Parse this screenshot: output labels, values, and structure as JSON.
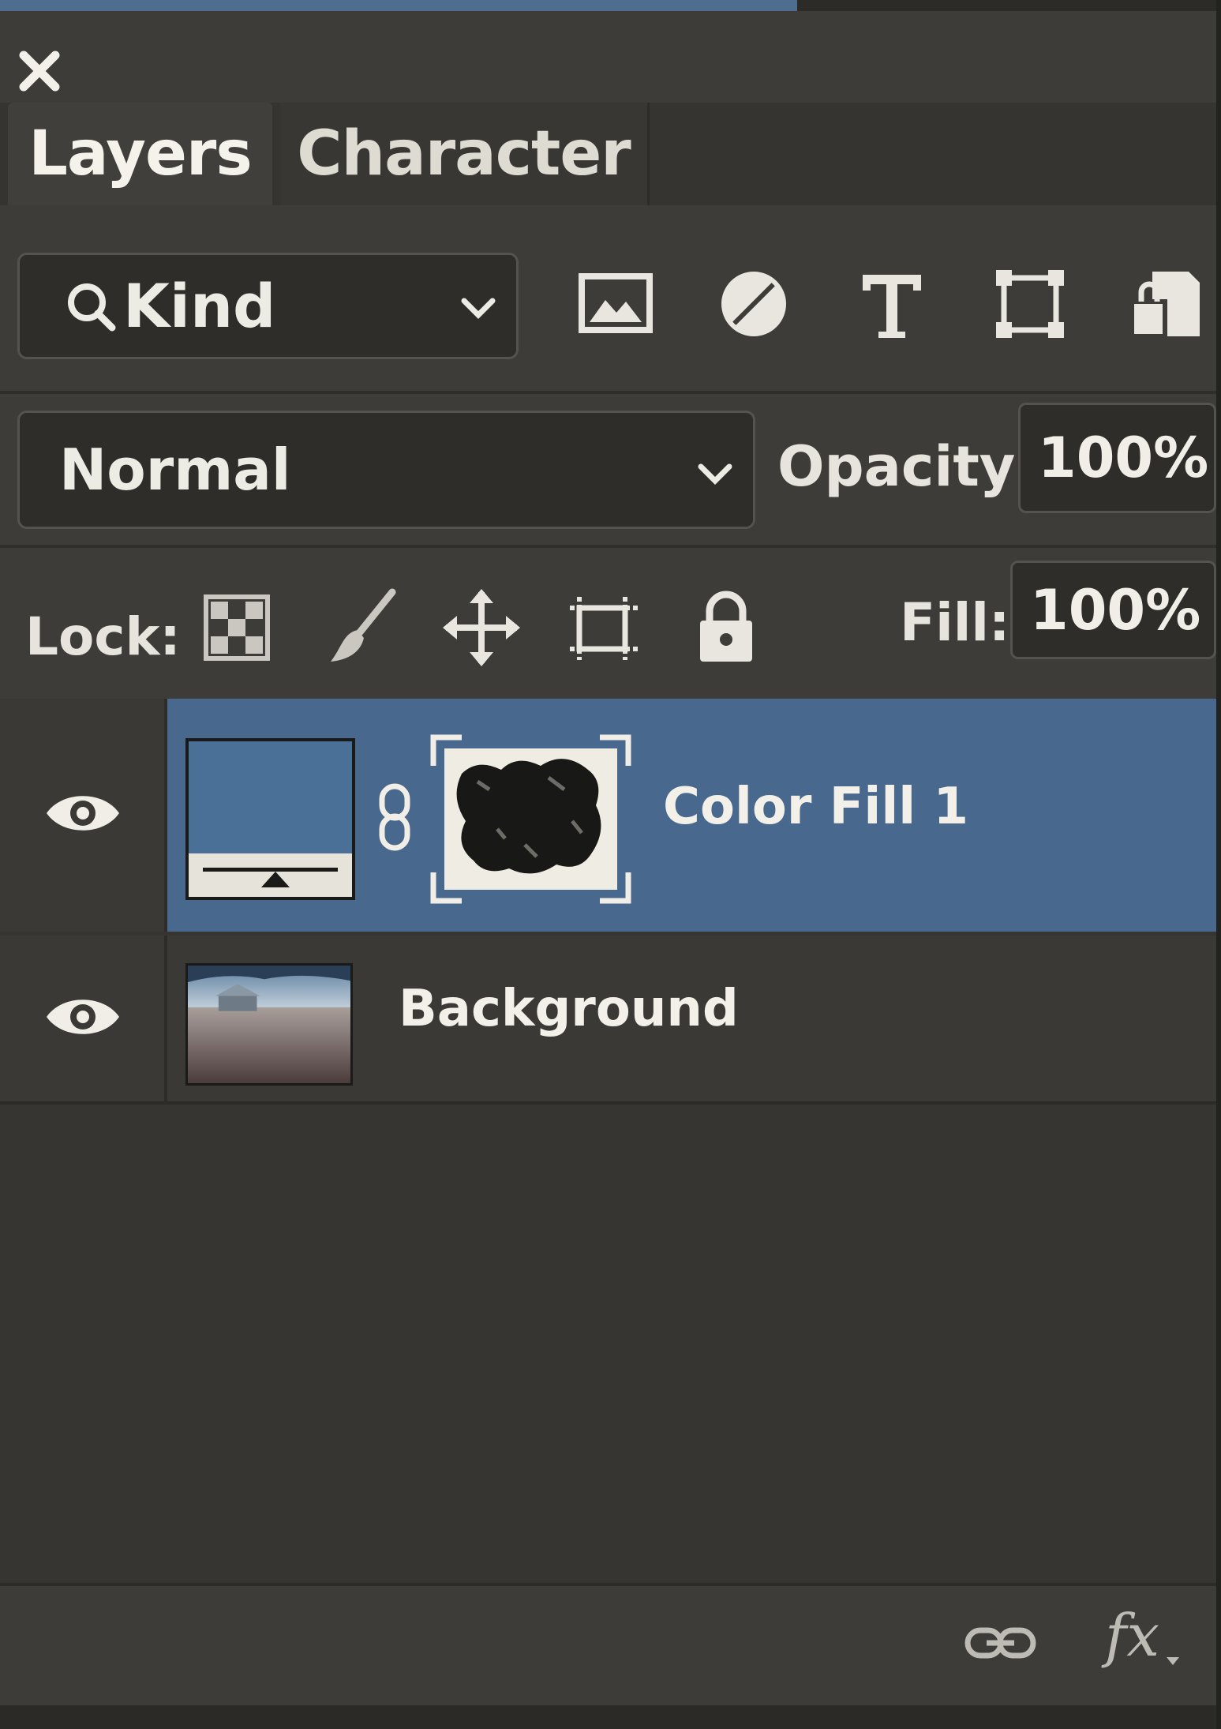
{
  "panel": {
    "tabs": [
      {
        "label": "Layers",
        "active": true
      },
      {
        "label": "Character",
        "active": false
      }
    ]
  },
  "filter": {
    "kind_label": "Kind",
    "filter_icons": [
      "image-filter-icon",
      "adjustment-filter-icon",
      "type-filter-icon",
      "shape-filter-icon",
      "smart-object-filter-icon"
    ]
  },
  "blend": {
    "mode": "Normal",
    "opacity_label": "Opacity:",
    "opacity_value": "100%"
  },
  "lock": {
    "label": "Lock:",
    "icons": [
      "lock-transparent-pixels-icon",
      "lock-image-pixels-icon",
      "lock-position-icon",
      "lock-artboard-icon",
      "lock-all-icon"
    ],
    "fill_label": "Fill:",
    "fill_value": "100%"
  },
  "layers": [
    {
      "name": "Color Fill 1",
      "selected": true,
      "visible": true,
      "fill_color": "#4a7098"
    },
    {
      "name": "Background",
      "selected": false,
      "visible": true
    }
  ],
  "footer": {
    "icons": [
      "link-layers-icon",
      "layer-effects-icon"
    ],
    "fx_label": "fx"
  },
  "colors": {
    "panel_bg": "#3d3c38",
    "selection": "#48698d",
    "text": "#e8e6df"
  }
}
